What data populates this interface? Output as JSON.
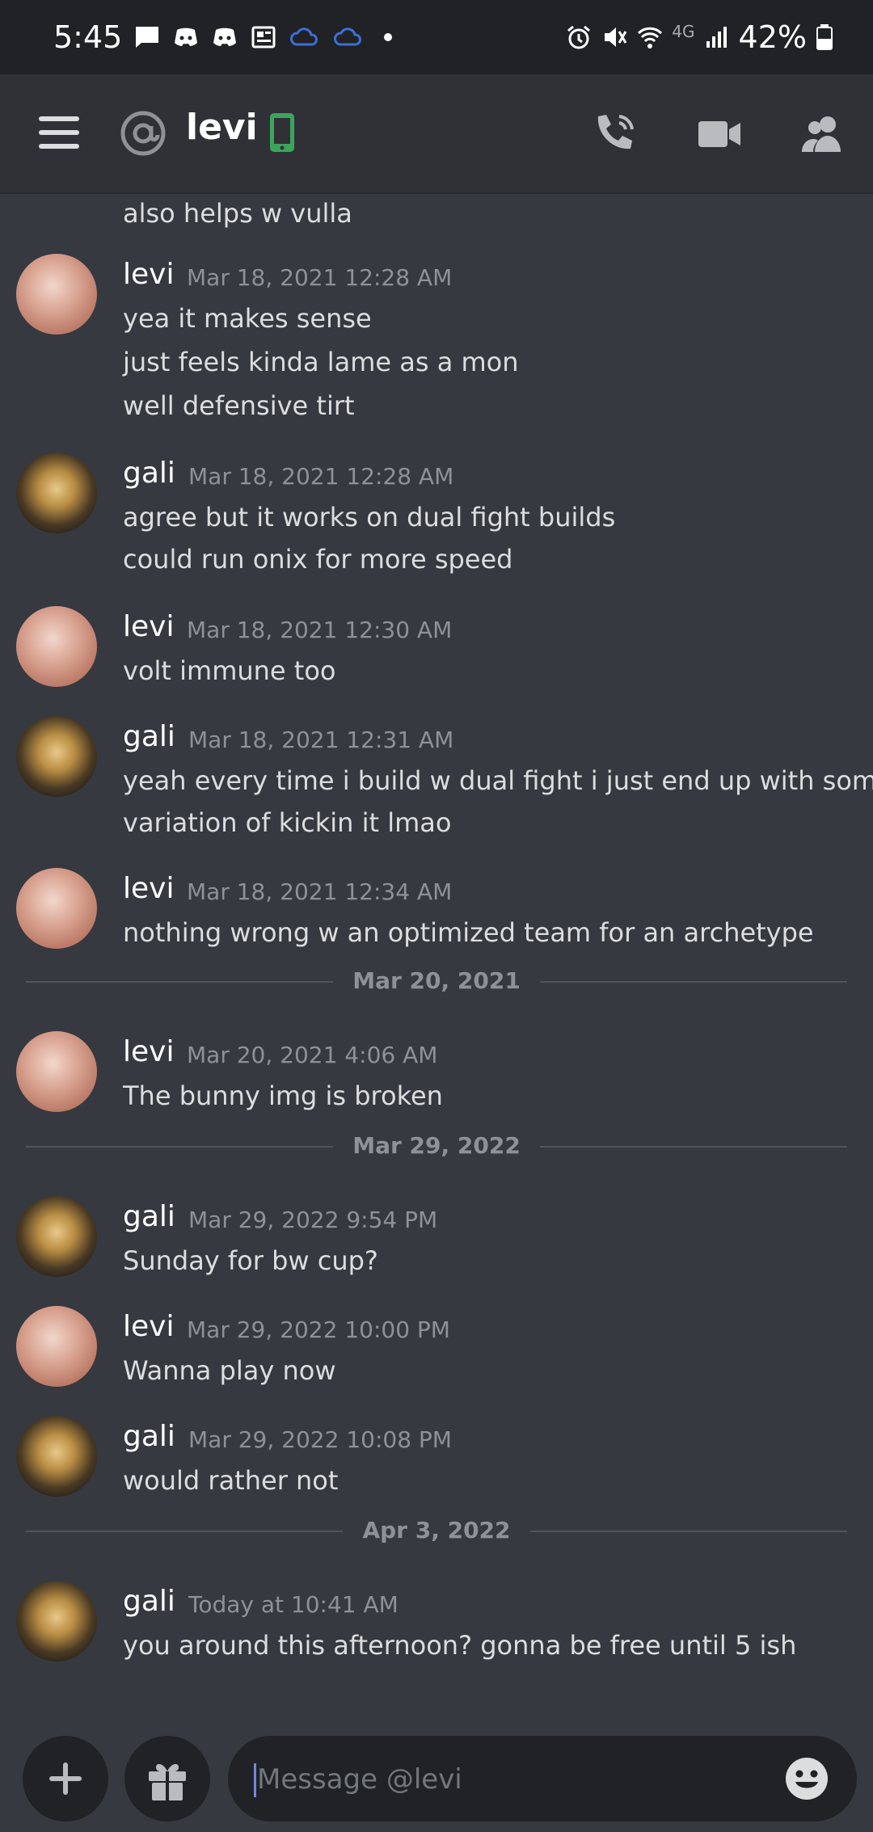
{
  "status_bar": {
    "time": "5:45",
    "network": "4G",
    "battery": "42%"
  },
  "header": {
    "channel_name": "levi",
    "icons": [
      "hamburger-menu-icon",
      "at-icon",
      "mobile-phone-icon",
      "voice-call-icon",
      "video-call-icon",
      "members-icon"
    ]
  },
  "messages": {
    "partial_line": "also helps w vulla",
    "groups": [
      {
        "author": "levi",
        "timestamp": "Mar 18, 2021 12:28 AM",
        "lines": [
          "yea it makes sense",
          "just feels kinda lame as a mon",
          "well defensive tirt"
        ]
      },
      {
        "author": "gali",
        "timestamp": "Mar 18, 2021 12:28 AM",
        "lines": [
          "agree but it works on dual fight builds",
          "could run onix for more speed"
        ]
      },
      {
        "author": "levi",
        "timestamp": "Mar 18, 2021 12:30 AM",
        "lines": [
          "volt immune too"
        ]
      },
      {
        "author": "gali",
        "timestamp": "Mar 18, 2021 12:31 AM",
        "lines": [
          "yeah every time i build w dual fight i just end up with some",
          "variation of kickin it lmao"
        ]
      },
      {
        "author": "levi",
        "timestamp": "Mar 18, 2021 12:34 AM",
        "lines": [
          "nothing wrong w an optimized team for an archetype"
        ]
      },
      {
        "author": "levi",
        "timestamp": "Mar 20, 2021 4:06 AM",
        "lines": [
          "The bunny img is broken"
        ]
      },
      {
        "author": "gali",
        "timestamp": "Mar 29, 2022 9:54 PM",
        "lines": [
          "Sunday for bw cup?"
        ]
      },
      {
        "author": "levi",
        "timestamp": "Mar 29, 2022 10:00 PM",
        "lines": [
          "Wanna play now"
        ]
      },
      {
        "author": "gali",
        "timestamp": "Mar 29, 2022 10:08 PM",
        "lines": [
          "would rather not"
        ]
      },
      {
        "author": "gali",
        "timestamp": "Today at 10:41 AM",
        "lines": [
          "you around this afternoon? gonna be free until 5 ish"
        ]
      }
    ],
    "dividers": [
      "Mar 20, 2021",
      "Mar 29, 2022",
      "Apr 3, 2022"
    ]
  },
  "composer": {
    "placeholder": "Message @levi",
    "icons": [
      "plus-icon",
      "gift-icon",
      "emoji-icon"
    ]
  }
}
